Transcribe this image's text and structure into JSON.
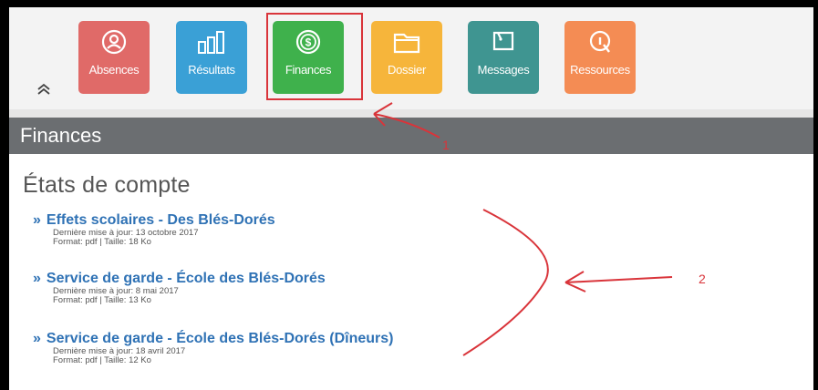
{
  "nav": {
    "tiles": [
      {
        "label": "Absences",
        "color": "#e06a68",
        "icon": "person-circle-icon"
      },
      {
        "label": "Résultats",
        "color": "#3aa0d6",
        "icon": "bar-chart-icon"
      },
      {
        "label": "Finances",
        "color": "#3fb14c",
        "icon": "dollar-coin-icon"
      },
      {
        "label": "Dossier",
        "color": "#f6b53b",
        "icon": "folder-icon"
      },
      {
        "label": "Messages",
        "color": "#3f9591",
        "icon": "message-icon"
      },
      {
        "label": "Ressources",
        "color": "#f48c54",
        "icon": "resource-icon"
      }
    ]
  },
  "section": {
    "title": "Finances",
    "subtitle": "États de compte"
  },
  "statements": [
    {
      "title": "Effets scolaires - Des Blés-Dorés",
      "updated": "Dernière mise à jour: 13 octobre 2017",
      "info": "Format: pdf | Taille: 18 Ko"
    },
    {
      "title": "Service de garde - École des Blés-Dorés",
      "updated": "Dernière mise à jour: 8 mai 2017",
      "info": "Format: pdf | Taille: 13 Ko"
    },
    {
      "title": "Service de garde - École des Blés-Dorés (Dîneurs)",
      "updated": "Dernière mise à jour: 18 avril 2017",
      "info": "Format: pdf | Taille: 12 Ko"
    }
  ],
  "annotations": {
    "one": "1",
    "two": "2"
  },
  "colors": {
    "accent": "#2f72b5",
    "header_bar": "#6b6e71",
    "annotation": "#d9343a"
  }
}
